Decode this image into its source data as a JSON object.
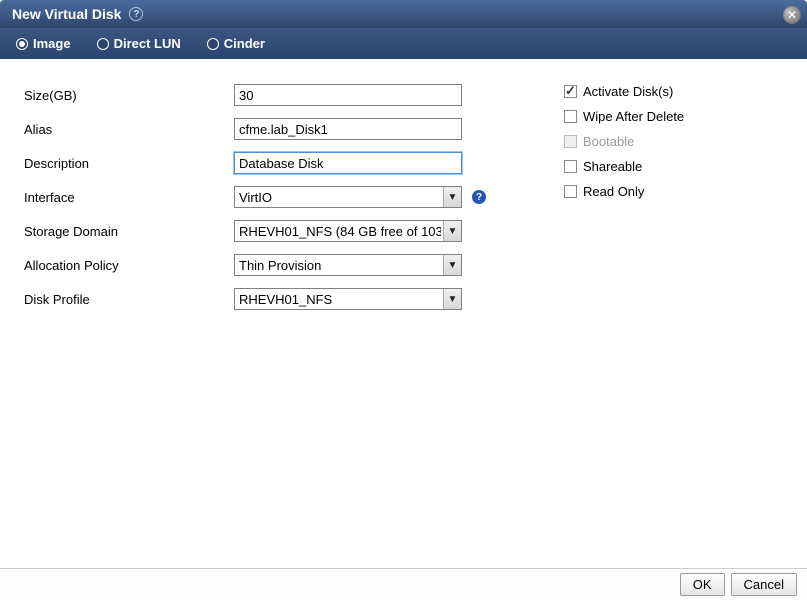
{
  "title": "New Virtual Disk",
  "tabs": {
    "image": "Image",
    "direct_lun": "Direct LUN",
    "cinder": "Cinder",
    "selected": "image"
  },
  "form": {
    "size_label": "Size(GB)",
    "size_value": "30",
    "alias_label": "Alias",
    "alias_value": "cfme.lab_Disk1",
    "description_label": "Description",
    "description_value": "Database Disk",
    "interface_label": "Interface",
    "interface_value": "VirtIO",
    "storage_domain_label": "Storage Domain",
    "storage_domain_value": "RHEVH01_NFS (84 GB free of 103",
    "allocation_label": "Allocation Policy",
    "allocation_value": "Thin Provision",
    "disk_profile_label": "Disk Profile",
    "disk_profile_value": "RHEVH01_NFS"
  },
  "options": {
    "activate": {
      "label": "Activate Disk(s)",
      "checked": true,
      "disabled": false
    },
    "wipe": {
      "label": "Wipe After Delete",
      "checked": false,
      "disabled": false
    },
    "bootable": {
      "label": "Bootable",
      "checked": false,
      "disabled": true
    },
    "shareable": {
      "label": "Shareable",
      "checked": false,
      "disabled": false
    },
    "readonly": {
      "label": "Read Only",
      "checked": false,
      "disabled": false
    }
  },
  "buttons": {
    "ok": "OK",
    "cancel": "Cancel"
  }
}
